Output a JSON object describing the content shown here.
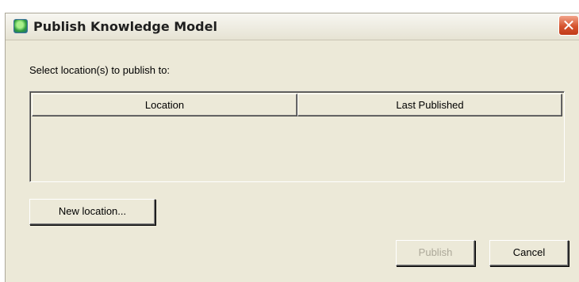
{
  "window": {
    "title": "Publish Knowledge Model",
    "icon": "app-globe-icon",
    "close_glyph": "✕"
  },
  "dialog": {
    "prompt": "Select location(s) to publish to:"
  },
  "table": {
    "columns": [
      "Location",
      "Last Published"
    ],
    "rows": []
  },
  "buttons": {
    "new_location": "New location...",
    "publish": "Publish",
    "publish_enabled": false,
    "cancel": "Cancel"
  },
  "colors": {
    "dialog_bg": "#ece9d8",
    "close_button": "#d5542f",
    "disabled_text": "#aca899"
  }
}
